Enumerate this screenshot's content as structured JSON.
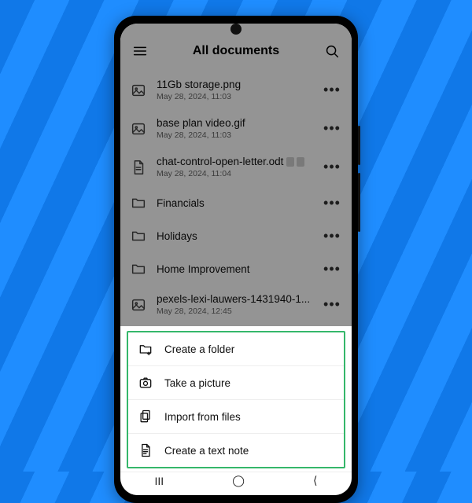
{
  "header": {
    "title": "All documents"
  },
  "items": [
    {
      "name": "11Gb storage.png",
      "sub": "May 28, 2024, 11:03",
      "type": "image"
    },
    {
      "name": "base plan video.gif",
      "sub": "May 28, 2024, 11:03",
      "type": "image"
    },
    {
      "name": "chat-control-open-letter.odt",
      "sub": "May 28, 2024, 11:04",
      "type": "doc",
      "badges": true
    },
    {
      "name": "Financials",
      "sub": "",
      "type": "folder"
    },
    {
      "name": "Holidays",
      "sub": "",
      "type": "folder"
    },
    {
      "name": "Home Improvement",
      "sub": "",
      "type": "folder"
    },
    {
      "name": "pexels-lexi-lauwers-1431940-1...",
      "sub": "May 28, 2024, 12:45",
      "type": "image"
    }
  ],
  "sheet": [
    {
      "label": "Create a folder",
      "icon": "folder-plus"
    },
    {
      "label": "Take a picture",
      "icon": "camera"
    },
    {
      "label": "Import from files",
      "icon": "files"
    },
    {
      "label": "Create a text note",
      "icon": "note"
    }
  ]
}
